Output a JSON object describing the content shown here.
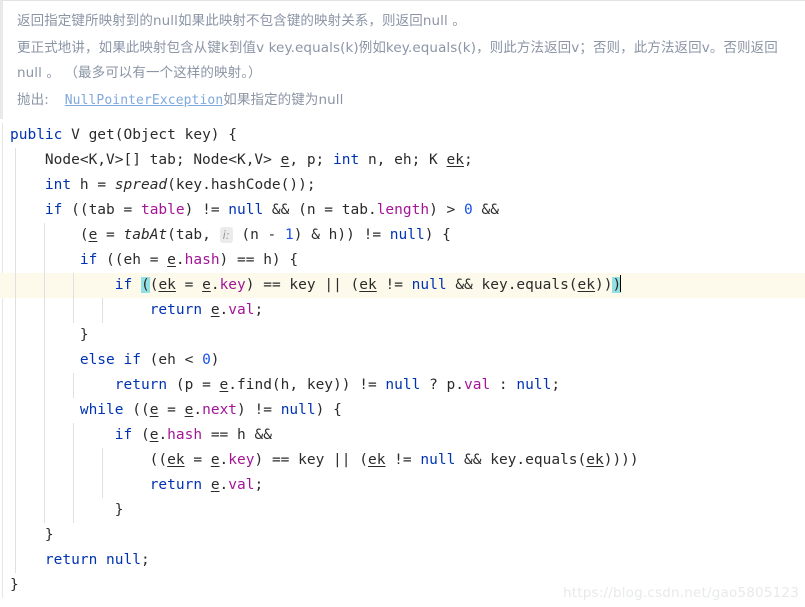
{
  "doc": {
    "paragraphs": [
      {
        "id": "doc-paragraph-1",
        "text": "返回指定键所映射到的null如果此映射不包含键的映射关系，则返回null 。"
      },
      {
        "id": "doc-paragraph-2",
        "text": "更正式地讲，如果此映射包含从键k到值v key.equals(k)例如key.equals(k)，则此方法返回v；否则，此方法返回v。否则返回null 。 （最多可以有一个这样的映射。）"
      }
    ],
    "throws_label": "抛出:",
    "throws_link": "NullPointerException",
    "throws_tail": "如果指定的键为null"
  },
  "editor": {
    "language": "java",
    "caret_line_index": 6,
    "inlay_hint": "i:",
    "watermark": "https://blog.csdn.net/gao5805123",
    "colors": {
      "keyword": "#0033b3",
      "number": "#1750eb",
      "field": "#a31596",
      "text": "#2b2b2b",
      "caret_line_bg": "#fdfaeb",
      "bracket_match_bg": "#93e0e3",
      "doc_text": "#8b95a6",
      "doc_link": "#7fa8dd",
      "watermark": "#e7e9eb"
    },
    "lines": [
      "public V get(Object key) {",
      "    Node<K,V>[] tab; Node<K,V> e, p; int n, eh; K ek;",
      "    int h = spread(key.hashCode());",
      "    if ((tab = table) != null && (n = tab.length) > 0 &&",
      "        (e = tabAt(tab, i: (n - 1) & h)) != null) {",
      "        if ((eh = e.hash) == h) {",
      "            if ((ek = e.key) == key || (ek != null && key.equals(ek)))",
      "                return e.val;",
      "        }",
      "        else if (eh < 0)",
      "            return (p = e.find(h, key)) != null ? p.val : null;",
      "        while ((e = e.next) != null) {",
      "            if (e.hash == h &&",
      "                ((ek = e.key) == key || (ek != null && key.equals(ek))))",
      "                return e.val;",
      "        }",
      "    }",
      "    return null;",
      "}"
    ]
  }
}
